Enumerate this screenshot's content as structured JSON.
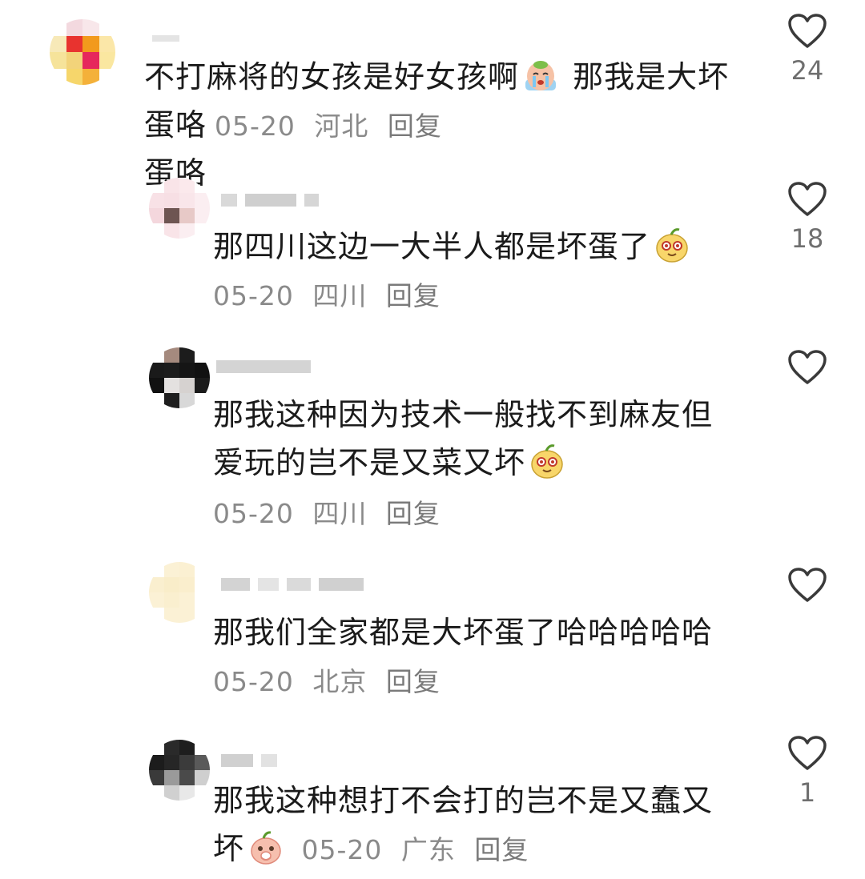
{
  "comments": [
    {
      "text": "不打麻将的女孩是好女孩啊",
      "emoji": "crying-emoji",
      "text_after": " 那我是大坏蛋咯",
      "date": "05-20",
      "location": "河北",
      "reply_label": "回复",
      "likes": "24",
      "heart_icon": "heart-outline-icon"
    },
    {
      "text": "那四川这边一大半人都是坏蛋了",
      "emoji": "smirk-pear-emoji",
      "date": "05-20",
      "location": "四川",
      "reply_label": "回复",
      "likes": "18",
      "heart_icon": "heart-outline-icon"
    },
    {
      "text_line1": "那我这种因为技术一般找不到麻友但",
      "text_line2": "爱玩的岂不是又菜又坏",
      "emoji": "smirk-pear-emoji",
      "date": "05-20",
      "location": "四川",
      "reply_label": "回复",
      "likes": "",
      "heart_icon": "heart-outline-icon"
    },
    {
      "text": "那我们全家都是大坏蛋了哈哈哈哈哈",
      "date": "05-20",
      "location": "北京",
      "reply_label": "回复",
      "likes": "",
      "heart_icon": "heart-outline-icon"
    },
    {
      "text_line1": "那我这种想打不会打的岂不是又蠢又",
      "text_line2": "坏",
      "emoji": "shy-peach-emoji",
      "date": "05-20",
      "location": "广东",
      "reply_label": "回复",
      "likes": "1",
      "heart_icon": "heart-outline-icon"
    }
  ],
  "colors": {
    "text": "#1b1b1b",
    "meta": "#8a8a8a",
    "heart_stroke": "#3a3a3a",
    "background": "#ffffff"
  }
}
